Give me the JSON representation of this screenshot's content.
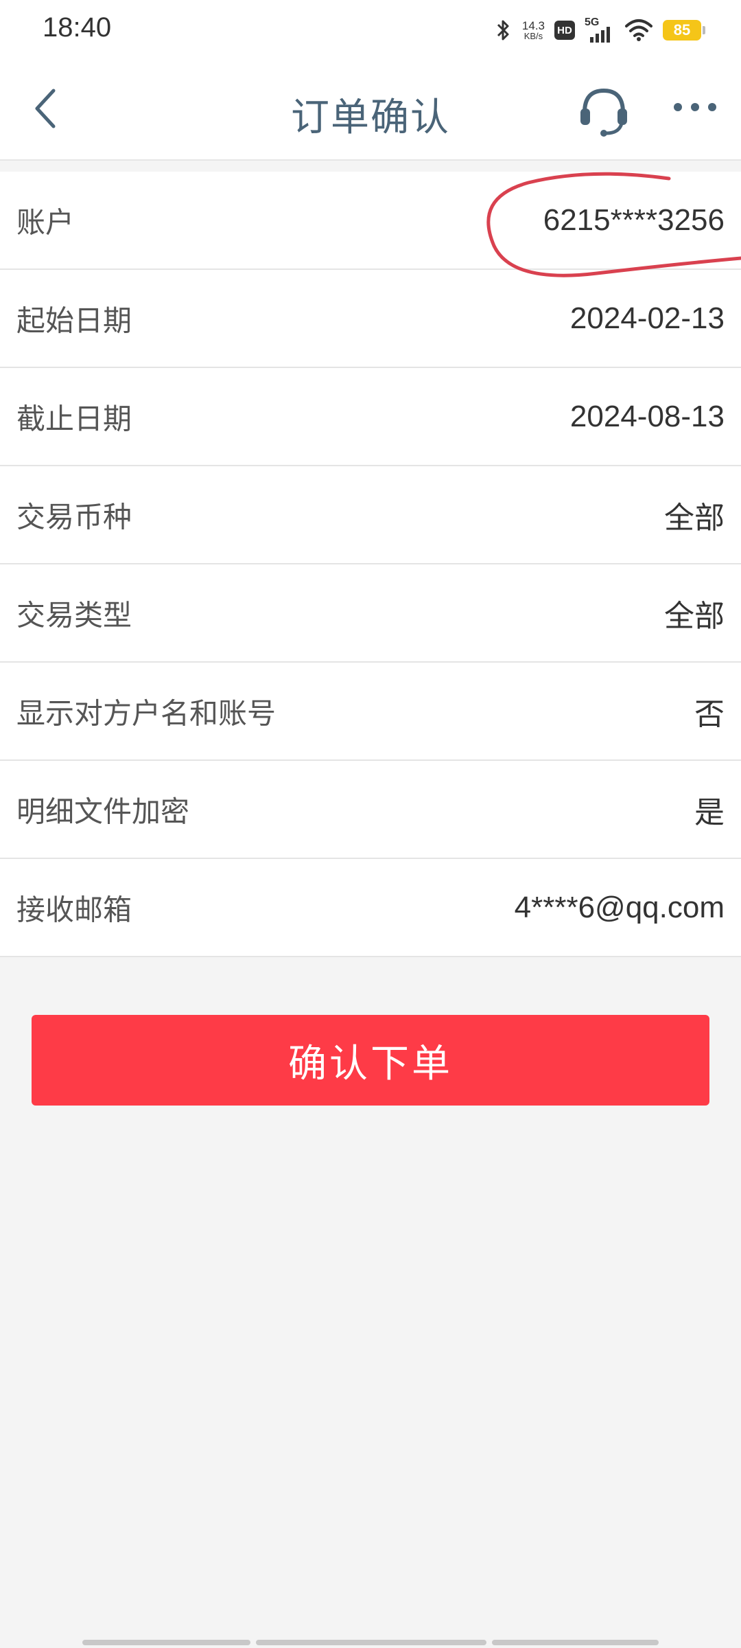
{
  "status_bar": {
    "time": "18:40",
    "net_speed_value": "14.3",
    "net_speed_unit": "KB/s",
    "hd_label": "HD",
    "network_label": "5G",
    "battery": "85",
    "battery_color": "#f5c518"
  },
  "nav": {
    "title": "订单确认",
    "back_icon": "chevron-left-icon",
    "service_icon": "headset-icon",
    "more_icon": "more-dots-icon"
  },
  "rows": [
    {
      "label": "账户",
      "value": "6215****3256"
    },
    {
      "label": "起始日期",
      "value": "2024-02-13"
    },
    {
      "label": "截止日期",
      "value": "2024-08-13"
    },
    {
      "label": "交易币种",
      "value": "全部"
    },
    {
      "label": "交易类型",
      "value": "全部"
    },
    {
      "label": "显示对方户名和账号",
      "value": "否"
    },
    {
      "label": "明细文件加密",
      "value": "是"
    },
    {
      "label": "接收邮箱",
      "value": "4****6@qq.com"
    }
  ],
  "confirm_button": {
    "label": "确认下单",
    "color": "#fe3b47"
  },
  "annotation": {
    "color": "#d9414f"
  }
}
